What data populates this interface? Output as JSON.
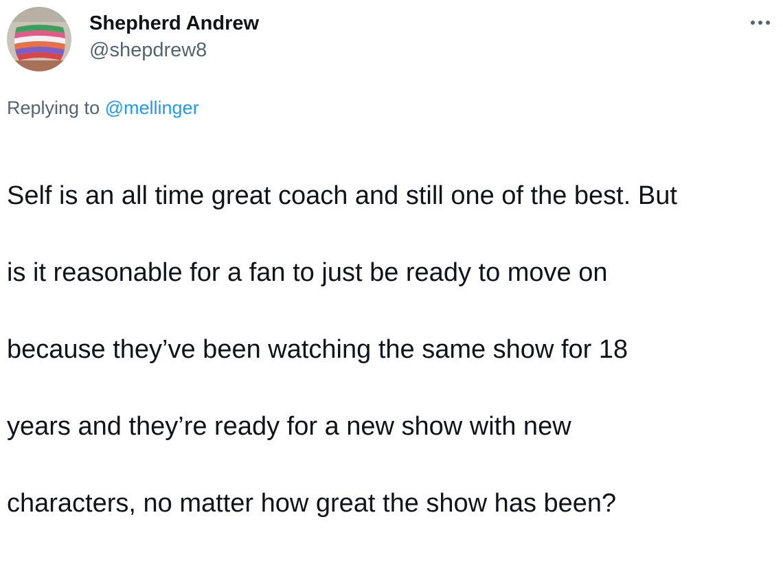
{
  "tweet": {
    "author_name": "Shepherd Andrew",
    "author_handle": "@shepdrew8",
    "more_icon": "more-horizontal-icon",
    "replying_prefix": "Replying to",
    "replying_mention": "@mellinger",
    "text_lines": [
      "Self is an all time great coach and still one of the best. But",
      "is it reasonable for a fan to just be ready to move on",
      "because they’ve been watching the same show for 18",
      "years and they’re ready for a new show with new",
      "characters, no matter how great the show has been?"
    ]
  },
  "colors": {
    "text_primary": "#0f1419",
    "text_secondary": "#536471",
    "link": "#1d9bf0"
  }
}
